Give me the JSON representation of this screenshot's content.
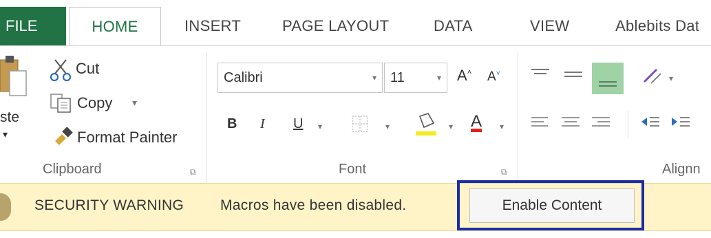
{
  "tabs": {
    "file": "FILE",
    "home": "HOME",
    "insert": "INSERT",
    "page_layout": "PAGE LAYOUT",
    "data": "DATA",
    "view": "VIEW",
    "ablebits": "Ablebits Dat"
  },
  "clipboard": {
    "paste": "ste",
    "cut": "Cut",
    "copy": "Copy",
    "format_painter": "Format Painter",
    "group_label": "Clipboard"
  },
  "font": {
    "font_name": "Calibri",
    "font_size": "11",
    "grow": "A",
    "shrink": "A",
    "bold": "B",
    "italic": "I",
    "underline": "U",
    "font_color": "A",
    "group_label": "Font"
  },
  "alignment": {
    "group_label": "Alignn"
  },
  "security_bar": {
    "title": "SECURITY WARNING",
    "message": "Macros have been disabled.",
    "button": "Enable Content"
  },
  "colors": {
    "file_tab": "#217346",
    "warning_bar": "#fff4c8",
    "highlight_border": "#1a2ea6",
    "font_color_bar": "#e0241a",
    "fill_color_bar": "#f4ec21"
  },
  "icons": [
    "cut-icon",
    "copy-icon",
    "format-painter-icon",
    "paste-icon",
    "borders-icon",
    "fill-color-icon",
    "align-icon",
    "orientation-icon",
    "indent-icon",
    "dialog-launcher-icon"
  ]
}
